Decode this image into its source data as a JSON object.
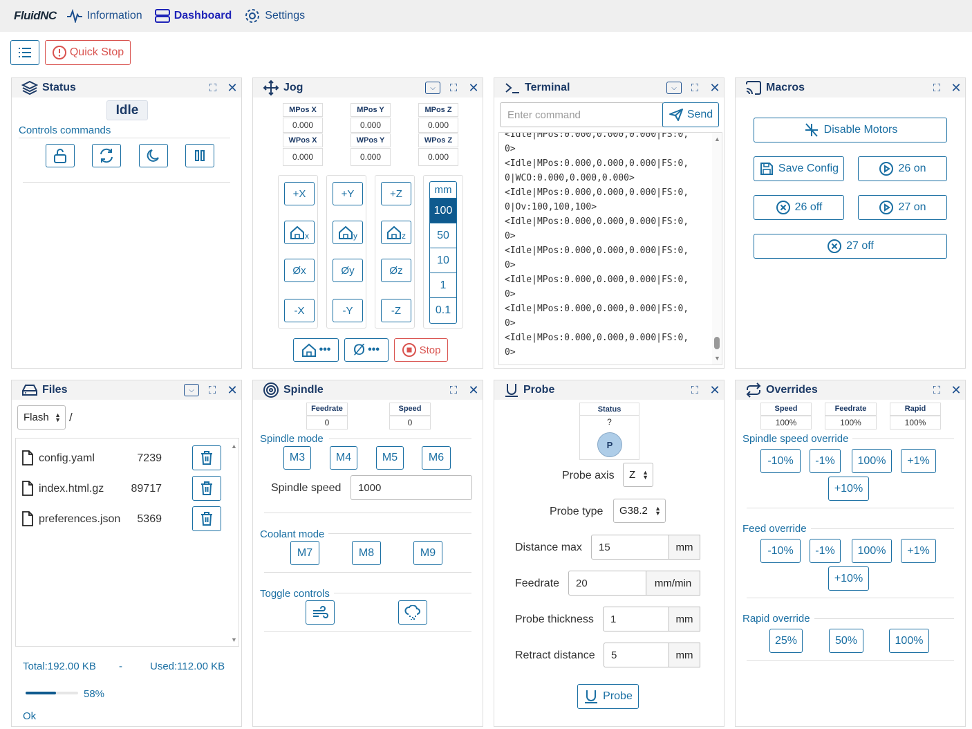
{
  "nav": {
    "brand": "FluidNC",
    "information": "Information",
    "dashboard": "Dashboard",
    "settings": "Settings"
  },
  "toolbar": {
    "quick_stop": "Quick Stop"
  },
  "status": {
    "title": "Status",
    "state": "Idle",
    "controls_title": "Controls commands"
  },
  "jog": {
    "title": "Jog",
    "mpos_x_label": "MPos X",
    "mpos_y_label": "MPos Y",
    "mpos_z_label": "MPos Z",
    "mpos_x": "0.000",
    "mpos_y": "0.000",
    "mpos_z": "0.000",
    "wpos_x_label": "WPos X",
    "wpos_y_label": "WPos Y",
    "wpos_z_label": "WPos Z",
    "wpos_x": "0.000",
    "wpos_y": "0.000",
    "wpos_z": "0.000",
    "plus_x": "+X",
    "plus_y": "+Y",
    "plus_z": "+Z",
    "minus_x": "-X",
    "minus_y": "-Y",
    "minus_z": "-Z",
    "home_x_sub": "x",
    "home_y_sub": "y",
    "home_z_sub": "z",
    "zero_x": "Øx",
    "zero_y": "Øy",
    "zero_z": "Øz",
    "unit": "mm",
    "steps": [
      "100",
      "50",
      "10",
      "1",
      "0.1"
    ],
    "selected_step": "100",
    "stop": "Stop"
  },
  "terminal": {
    "title": "Terminal",
    "placeholder": "Enter command",
    "send": "Send",
    "lines": [
      "<Idle|MPos:0.000,0.000,0.000|FS:0,",
      "0>",
      "<Idle|MPos:0.000,0.000,0.000|FS:0,",
      "0|WCO:0.000,0.000,0.000>",
      "<Idle|MPos:0.000,0.000,0.000|FS:0,",
      "0|Ov:100,100,100>",
      "<Idle|MPos:0.000,0.000,0.000|FS:0,",
      "0>",
      "<Idle|MPos:0.000,0.000,0.000|FS:0,",
      "0>",
      "<Idle|MPos:0.000,0.000,0.000|FS:0,",
      "0>",
      "<Idle|MPos:0.000,0.000,0.000|FS:0,",
      "0>",
      "<Idle|MPos:0.000,0.000,0.000|FS:0,",
      "0>"
    ]
  },
  "macros": {
    "title": "Macros",
    "disable_motors": "Disable Motors",
    "save_config": "Save Config",
    "on26": "26 on",
    "off26": "26 off",
    "on27": "27 on",
    "off27": "27 off"
  },
  "files": {
    "title": "Files",
    "fs": "Flash",
    "path": "/",
    "items": [
      {
        "name": "config.yaml",
        "size": "7239"
      },
      {
        "name": "index.html.gz",
        "size": "89717"
      },
      {
        "name": "preferences.json",
        "size": "5369"
      }
    ],
    "total": "Total:192.00 KB",
    "dash": "-",
    "used": "Used:112.00 KB",
    "percent": "58%",
    "percent_value": 58,
    "status": "Ok"
  },
  "spindle": {
    "title": "Spindle",
    "feedrate_label": "Feedrate",
    "feedrate": "0",
    "speed_label": "Speed",
    "speed": "0",
    "mode_title": "Spindle mode",
    "m3": "M3",
    "m4": "M4",
    "m5": "M5",
    "m6": "M6",
    "speed_field_label": "Spindle speed",
    "speed_value": "1000",
    "coolant_title": "Coolant mode",
    "m7": "M7",
    "m8": "M8",
    "m9": "M9",
    "toggle_title": "Toggle controls"
  },
  "probe": {
    "title": "Probe",
    "status_label": "Status",
    "status_value": "?",
    "led": "P",
    "axis_label": "Probe axis",
    "axis": "Z",
    "type_label": "Probe type",
    "type": "G38.2",
    "dist_label": "Distance max",
    "dist": "15",
    "dist_unit": "mm",
    "feed_label": "Feedrate",
    "feed": "20",
    "feed_unit": "mm/min",
    "thick_label": "Probe thickness",
    "thick": "1",
    "thick_unit": "mm",
    "retract_label": "Retract distance",
    "retract": "5",
    "retract_unit": "mm",
    "button": "Probe"
  },
  "overrides": {
    "title": "Overrides",
    "speed_label": "Speed",
    "speed": "100%",
    "feedrate_label": "Feedrate",
    "feedrate": "100%",
    "rapid_label": "Rapid",
    "rapid": "100%",
    "spindle_title": "Spindle speed override",
    "feed_title": "Feed override",
    "rapid_title": "Rapid override",
    "m10": "-10%",
    "m1": "-1%",
    "p100": "100%",
    "p1": "+1%",
    "p10": "+10%",
    "r25": "25%",
    "r50": "50%",
    "r100": "100%"
  }
}
